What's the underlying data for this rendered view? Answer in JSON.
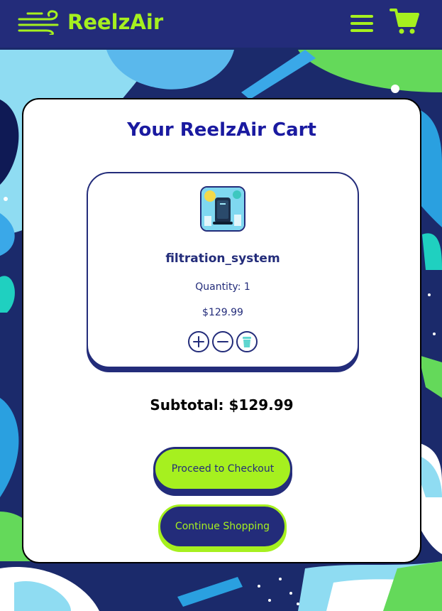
{
  "header": {
    "brand": "ReelzAir",
    "logo_icon": "wind-icon",
    "menu_icon": "hamburger-menu-icon",
    "cart_icon": "shopping-cart-icon"
  },
  "cart": {
    "title": "Your ReelzAir Cart",
    "items": [
      {
        "name": "filtration_system",
        "quantity_text": "Quantity: 1",
        "price": "$129.99",
        "thumbnail_icon": "air-purifier-image",
        "actions": [
          "plus-icon",
          "minus-icon",
          "trash-icon"
        ]
      }
    ],
    "subtotal": "Subtotal: $129.99",
    "checkout_label": "Proceed to Checkout",
    "continue_label": "Continue Shopping"
  },
  "colors": {
    "navy": "#232c7a",
    "lime": "#a6f01f",
    "title_blue": "#1a1aa0",
    "card_bg": "#ffffff",
    "trash_teal": "#5fd6d0"
  }
}
